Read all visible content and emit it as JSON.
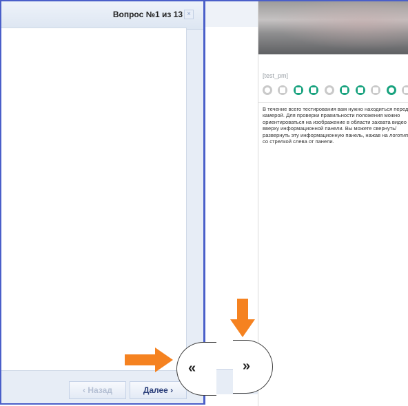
{
  "left_panel": {
    "question_title": "Вопрос №1 из 13",
    "close_glyph": "×",
    "back_label": "‹ Назад",
    "next_label": "Далее ›",
    "collapse_glyph": "«"
  },
  "right_panel": {
    "username": "[test_pm]",
    "status_icons": [
      {
        "name": "icon-1",
        "active": false
      },
      {
        "name": "icon-2",
        "active": false
      },
      {
        "name": "icon-3",
        "active": true
      },
      {
        "name": "icon-4",
        "active": true
      },
      {
        "name": "icon-5",
        "active": false
      },
      {
        "name": "icon-6",
        "active": true
      },
      {
        "name": "icon-7",
        "active": true
      },
      {
        "name": "icon-8",
        "active": false
      },
      {
        "name": "icon-9",
        "active": true
      },
      {
        "name": "icon-10",
        "active": false
      }
    ],
    "instructions": "В течение всего тестирования вам нужно находиться перед камерой. Для проверки правильности положения можно ориентироваться на изображение в области захвата видео вверху информационной панели. Вы можете свернуть/ развернуть эту информационную панель, нажав на логотип со стрелкой слева от панели.",
    "expand_glyph": "»"
  },
  "colors": {
    "accent_border": "#4a5fc9",
    "status_active": "#18a27e",
    "status_inactive": "#c9c9c9",
    "annotation_arrow": "#f58220"
  }
}
